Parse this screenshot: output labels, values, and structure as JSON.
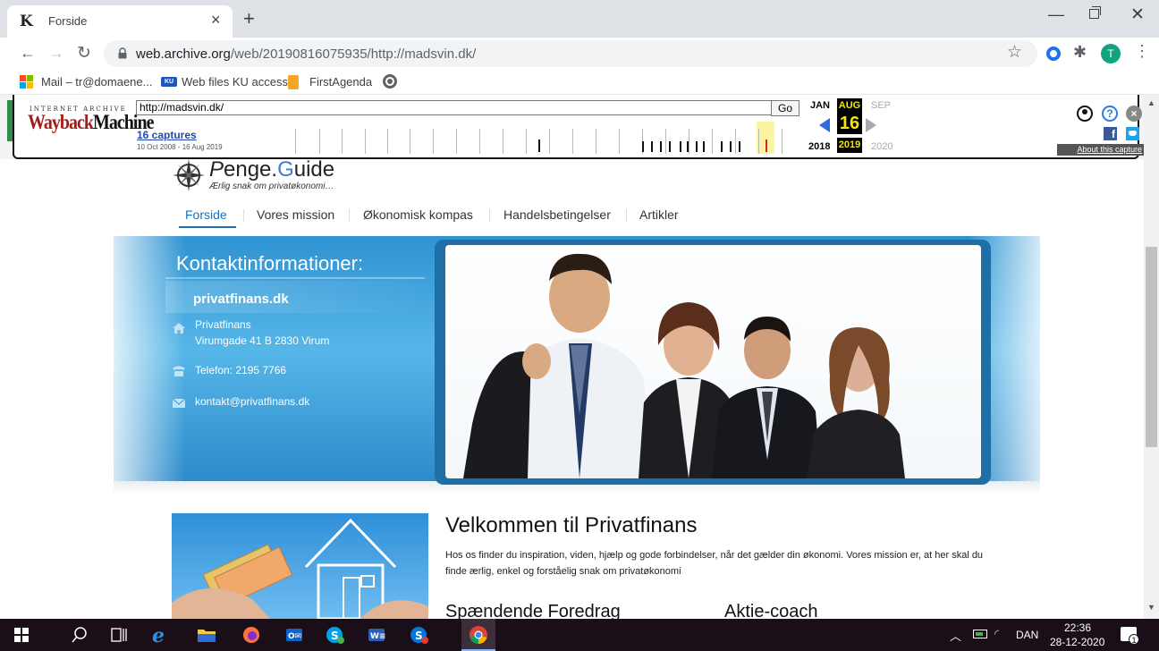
{
  "browser": {
    "tab_title": "Forside",
    "tab_favicon_letter": "K",
    "url_host": "web.archive.org",
    "url_path": "/web/20190816075935/http://madsvin.dk/",
    "profile_initial": "T",
    "bookmarks": [
      {
        "label": "Mail – tr@domaene...",
        "icon": "microsoft-icon"
      },
      {
        "label": "Web files KU access",
        "icon": "ku-icon"
      },
      {
        "label": "FirstAgenda",
        "icon": "firstagenda-icon"
      },
      {
        "label": "",
        "icon": "globe-icon"
      }
    ]
  },
  "wayback": {
    "ia_label": "INTERNET ARCHIVE",
    "logo_part1": "Wayback",
    "logo_part2": "Machine",
    "url_value": "http://madsvin.dk/",
    "go_label": "Go",
    "captures_label": "16 captures",
    "capture_range": "10 Oct 2008 - 16 Aug 2019",
    "months": {
      "prev": "JAN",
      "current": "AUG",
      "next": "SEP"
    },
    "day": "16",
    "years": {
      "prev": "2018",
      "current": "2019",
      "next": "2020"
    },
    "about_label": "About this capture",
    "fb_label": "f"
  },
  "site": {
    "logo_text_1": "enge.",
    "logo_text_2": "G",
    "logo_text_3": "uide",
    "logo_prefix": "P",
    "tagline": "Ærlig snak om privatøkonomi…",
    "nav": [
      {
        "label": "Forside",
        "active": true
      },
      {
        "label": "Vores mission",
        "active": false
      },
      {
        "label": "Økonomisk kompas",
        "active": false
      },
      {
        "label": "Handelsbetingelser",
        "active": false
      },
      {
        "label": "Artikler",
        "active": false
      }
    ],
    "contact": {
      "title": "Kontaktinformationer:",
      "site_name": "privatfinans.dk",
      "address_line1": "Privatfinans",
      "address_line2": "Virumgade 41 B 2830 Virum",
      "phone": "Telefon: 2195 7766",
      "email": "kontakt@privatfinans.dk"
    },
    "welcome_title": "Velkommen til Privatfinans",
    "welcome_text": "Hos os finder du inspiration, viden, hjælp og gode forbindelser, når det gælder din økonomi. Vores mission er, at her skal du finde ærlig, enkel og forståelig snak om privatøkonomi",
    "section1_title": "Spændende Foredrag",
    "section2_title": "Aktie-coach"
  },
  "taskbar": {
    "language": "DAN",
    "time": "22:36",
    "date": "28-12-2020",
    "notification_count": "1"
  }
}
